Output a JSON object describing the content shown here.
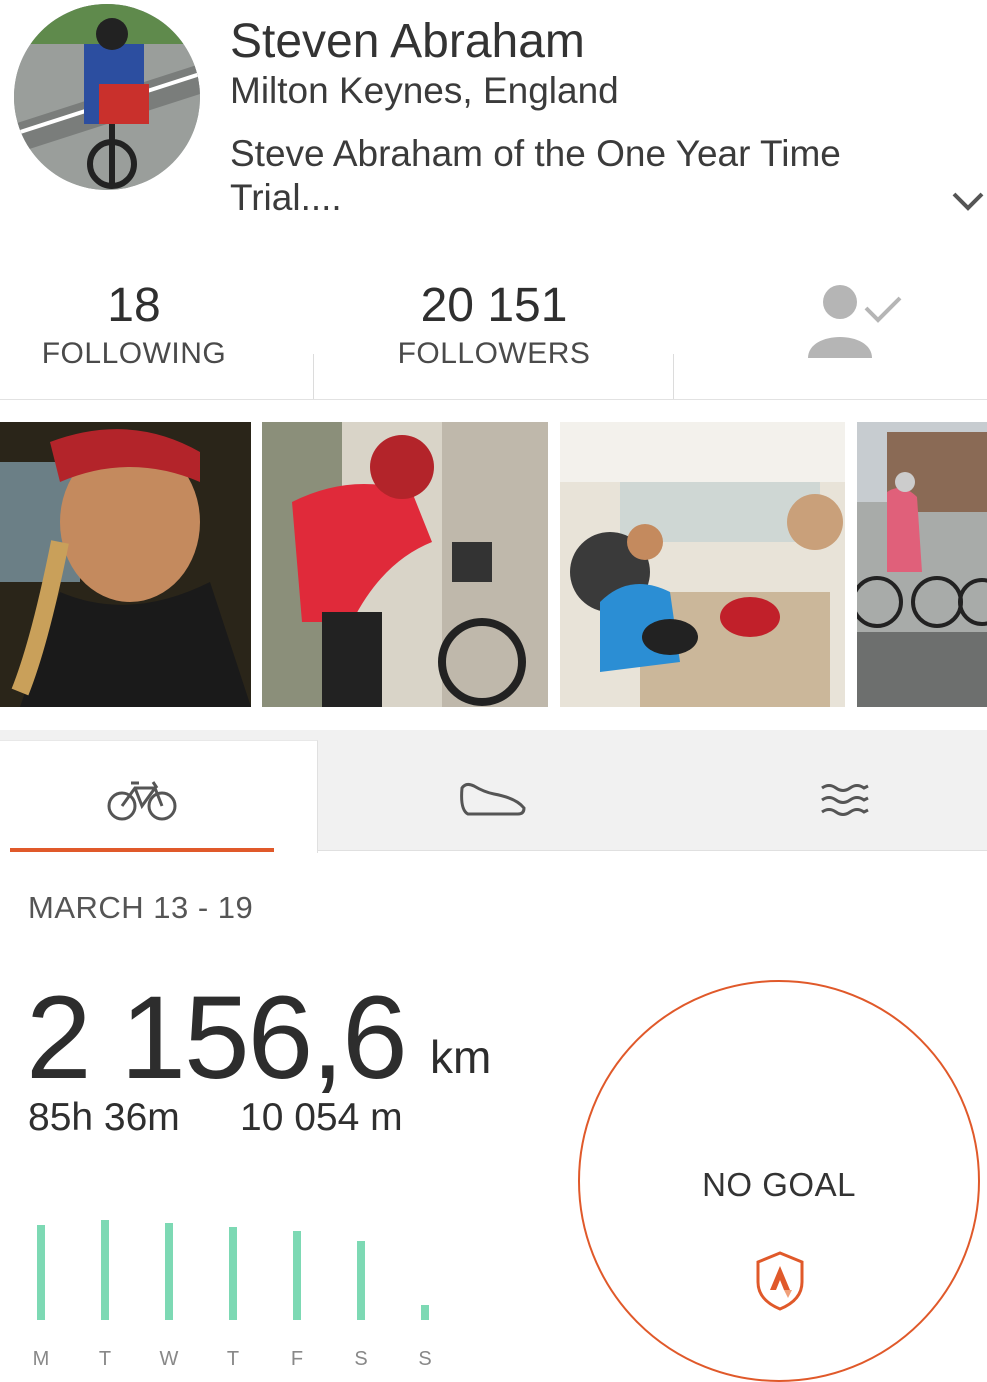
{
  "profile": {
    "name": "Steven Abraham",
    "location": "Milton Keynes, England",
    "bio": "Steve Abraham of the One Year Time Trial...."
  },
  "stats": {
    "following_count": "18",
    "following_label": "FOLLOWING",
    "followers_count": "20 151",
    "followers_label": "FOLLOWERS"
  },
  "photos": [
    {
      "subject": "selfie-night-rider"
    },
    {
      "subject": "rider-red-jacket-bike"
    },
    {
      "subject": "cafe-group"
    },
    {
      "subject": "riders-street"
    }
  ],
  "tabs": [
    {
      "icon": "bike-icon",
      "active": true
    },
    {
      "icon": "shoe-icon",
      "active": false
    },
    {
      "icon": "swim-icon",
      "active": false
    }
  ],
  "week": {
    "range": "MARCH 13 - 19",
    "distance": "2 156,6",
    "unit": "km",
    "time": "85h 36m",
    "elevation": "10 054 m",
    "goal_label": "NO GOAL",
    "daily_fraction": [
      0.95,
      1.0,
      0.97,
      0.93,
      0.89,
      0.79,
      0.15
    ],
    "day_labels": [
      "M",
      "T",
      "W",
      "T",
      "F",
      "S",
      "S"
    ]
  },
  "colors": {
    "accent": "#e0592a",
    "bar": "#7dd9b4",
    "text": "#333333"
  }
}
